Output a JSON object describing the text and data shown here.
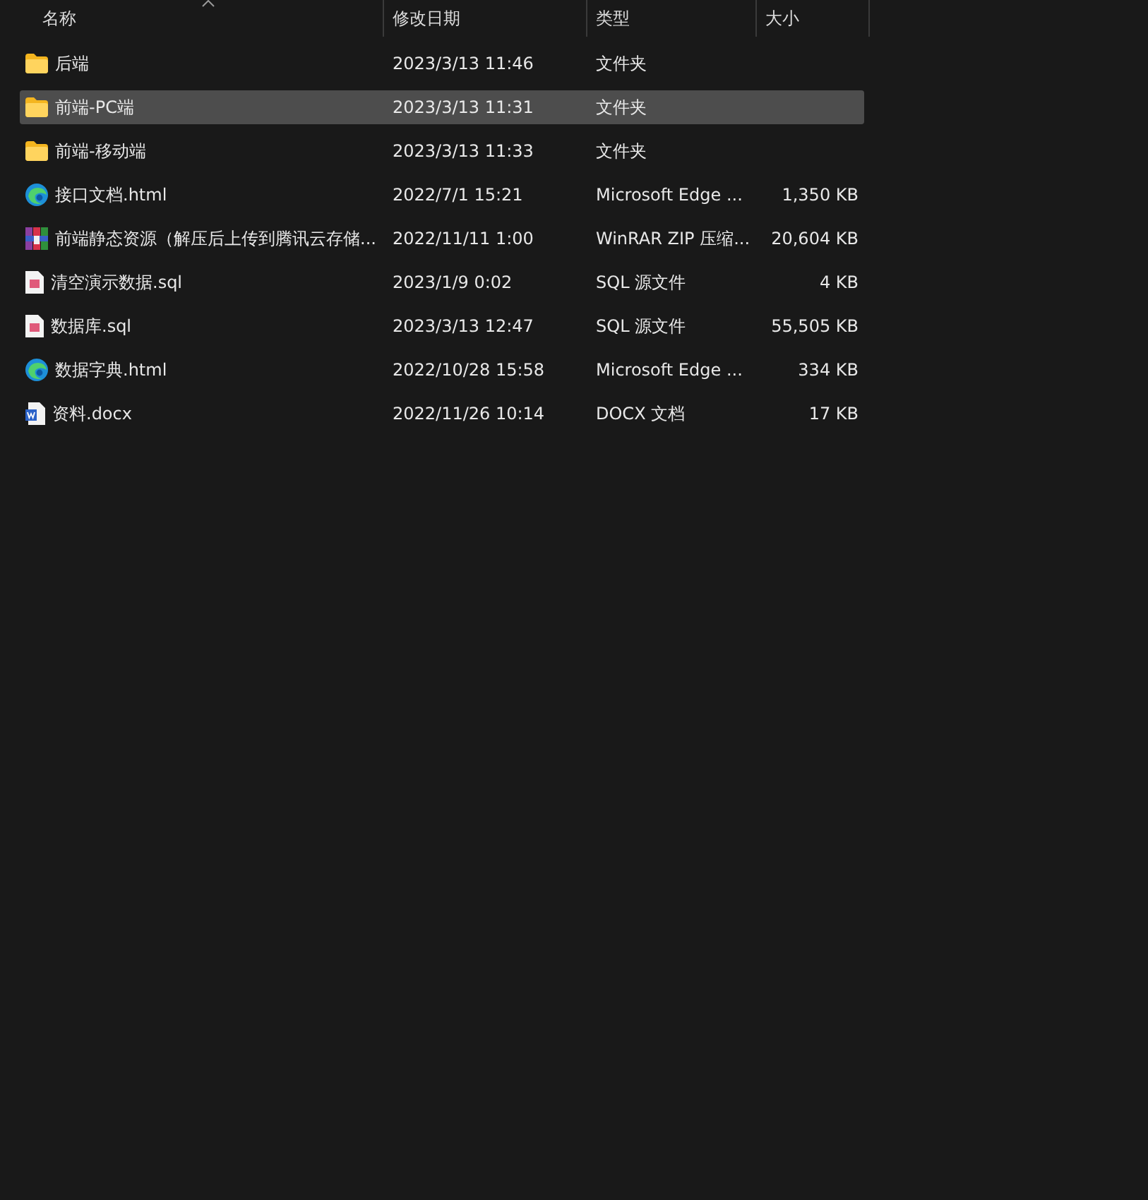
{
  "columns": [
    "名称",
    "修改日期",
    "类型",
    "大小"
  ],
  "rows": [
    {
      "name": "后端",
      "date": "2023/3/13 11:46",
      "type": "文件夹",
      "kind": "folder",
      "selected": false
    },
    {
      "name": "前端-PC端",
      "date": "2023/3/13 11:31",
      "type": "文件夹",
      "kind": "folder",
      "selected": true
    },
    {
      "name": "前端-移动端",
      "date": "2023/3/13 11:33",
      "type": "文件夹",
      "kind": "folder",
      "selected": false
    },
    {
      "name": "接口文档.html",
      "date": "2022/7/1 15:21",
      "type": "Microsoft Edge ...",
      "size": "1,350 KB",
      "kind": "edge",
      "selected": false
    },
    {
      "name": "前端静态资源（解压后上传到腾讯云存储...",
      "date": "2022/11/11 1:00",
      "type": "WinRAR ZIP 压缩...",
      "size": "20,604 KB",
      "kind": "archive",
      "selected": false
    },
    {
      "name": "清空演示数据.sql",
      "date": "2023/1/9 0:02",
      "type": "SQL 源文件",
      "size": "4 KB",
      "kind": "sql",
      "selected": false
    },
    {
      "name": "数据库.sql",
      "date": "2023/3/13 12:47",
      "type": "SQL 源文件",
      "size": "55,505 KB",
      "kind": "sql",
      "selected": false
    },
    {
      "name": "数据字典.html",
      "date": "2022/10/28 15:58",
      "type": "Microsoft Edge ...",
      "size": "334 KB",
      "kind": "edge",
      "selected": false
    },
    {
      "name": "资料.docx",
      "date": "2022/11/26 10:14",
      "type": "DOCX 文档",
      "size": "17 KB",
      "kind": "docx",
      "selected": false
    }
  ]
}
